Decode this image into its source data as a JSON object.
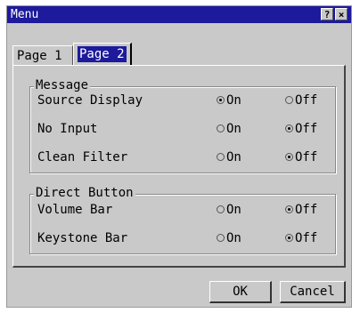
{
  "window": {
    "title": "Menu",
    "help_label": "?",
    "close_label": "×"
  },
  "tabs": [
    {
      "label": "Page 1",
      "selected": false
    },
    {
      "label": "Page 2",
      "selected": true
    }
  ],
  "groups": {
    "message": {
      "title": "Message",
      "rows": [
        {
          "label": "Source Display",
          "on_label": "On",
          "off_label": "Off",
          "value": "On"
        },
        {
          "label": "No Input",
          "on_label": "On",
          "off_label": "Off",
          "value": "Off"
        },
        {
          "label": "Clean Filter",
          "on_label": "On",
          "off_label": "Off",
          "value": "Off"
        }
      ]
    },
    "direct_button": {
      "title": "Direct Button",
      "rows": [
        {
          "label": "Volume Bar",
          "on_label": "On",
          "off_label": "Off",
          "value": "Off"
        },
        {
          "label": "Keystone Bar",
          "on_label": "On",
          "off_label": "Off",
          "value": "Off"
        }
      ]
    }
  },
  "buttons": {
    "ok_label": "OK",
    "cancel_label": "Cancel"
  }
}
